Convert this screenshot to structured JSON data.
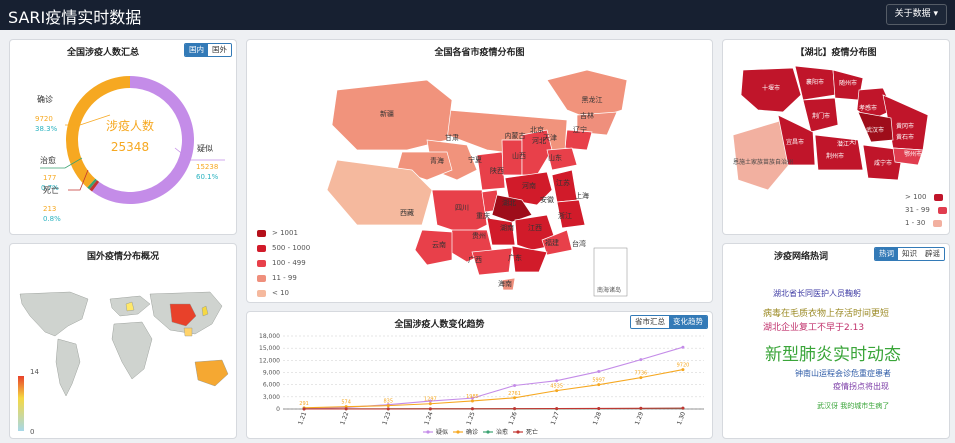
{
  "header": {
    "title": "SARI疫情实时数据",
    "about_label": "关于数据 ▾"
  },
  "summary": {
    "title": "全国涉疫人数汇总",
    "tabs": [
      "国内",
      "国外"
    ],
    "center_label": "涉疫人数",
    "center_value": "25348",
    "items": [
      {
        "label": "确诊",
        "count": "9720",
        "pct": "38.3%",
        "color": "#f6a821"
      },
      {
        "label": "治愈",
        "count": "177",
        "pct": "0.7%",
        "color": "#3ba272"
      },
      {
        "label": "死亡",
        "count": "213",
        "pct": "0.8%",
        "color": "#c23531"
      },
      {
        "label": "疑似",
        "count": "15238",
        "pct": "60.1%",
        "color": "#c48ce8"
      }
    ]
  },
  "china_map": {
    "title": "全国各省市疫情分布图",
    "legend": [
      {
        "label": "> 1001",
        "color": "#b5101a"
      },
      {
        "label": "500 - 1000",
        "color": "#d11b2a"
      },
      {
        "label": "100 - 499",
        "color": "#e8404a"
      },
      {
        "label": "11 - 99",
        "color": "#ef8f7c"
      },
      {
        "label": "< 10",
        "color": "#f5b99e"
      }
    ],
    "labels": [
      "黑龙江",
      "吉林",
      "辽宁",
      "内蒙古",
      "新疆",
      "甘肃",
      "宁夏",
      "青海",
      "西藏",
      "四川",
      "重庆",
      "陕西",
      "山西",
      "河北",
      "北京",
      "天津",
      "山东",
      "河南",
      "湖北",
      "湖南",
      "江苏",
      "安徽",
      "上海",
      "浙江",
      "江西",
      "福建",
      "广东",
      "广西",
      "贵州",
      "云南",
      "海南",
      "台湾"
    ],
    "inset_label": "南海诸岛"
  },
  "hubei_map": {
    "title": "【湖北】疫情分布图",
    "labels": [
      "十堰市",
      "襄阳市",
      "随州市",
      "孝感市",
      "荆门市",
      "黄冈市",
      "武汉市",
      "恩施土家族苗族自治州",
      "宜昌市",
      "荆州市",
      "咸宁市",
      "鄂州市",
      "黄石市",
      "潜江",
      "天门"
    ],
    "legend": [
      {
        "label": "> 100",
        "color": "#c0152a"
      },
      {
        "label": "31 - 99",
        "color": "#e03d4f"
      },
      {
        "label": "1 - 30",
        "color": "#f2b0a0"
      }
    ]
  },
  "world_map": {
    "title": "国外疫情分布概况",
    "scale_max": "14",
    "scale_min": "0"
  },
  "trend": {
    "title": "全国涉疫人数变化趋势",
    "tabs": [
      "省市汇总",
      "变化趋势"
    ],
    "legend": [
      "疑似",
      "确诊",
      "治愈",
      "死亡"
    ]
  },
  "hotwords": {
    "title": "涉疫网络热词",
    "tabs": [
      "热词",
      "知识",
      "辟谣"
    ],
    "words": [
      {
        "text": "湖北省长同医护人员鞠躬",
        "color": "#3d3aa3",
        "size": 8
      },
      {
        "text": "病毒在毛质衣物上存活时间更短",
        "color": "#9b8a24",
        "size": 9
      },
      {
        "text": "湖北企业复工不早于2.13",
        "color": "#c0306b",
        "size": 9
      },
      {
        "text": "新型肺炎实时动态",
        "color": "#3aa539",
        "size": 17
      },
      {
        "text": "钟南山运程会诊危重症患者",
        "color": "#2c5aa6",
        "size": 8
      },
      {
        "text": "疫情拐点将出现",
        "color": "#7a3aa6",
        "size": 8
      },
      {
        "text": "武汉伢 我的城市生病了",
        "color": "#3aa539",
        "size": 7
      }
    ]
  },
  "chart_data": {
    "type": "line",
    "categories": [
      "1.21",
      "1.22",
      "1.23",
      "1.24",
      "1.25",
      "1.26",
      "1.27",
      "1.28",
      "1.29",
      "1.30"
    ],
    "ylim": [
      0,
      18000
    ],
    "yticks": [
      "0",
      "3,000",
      "6,000",
      "9,000",
      "12,000",
      "15,000",
      "18,000"
    ],
    "series": [
      {
        "name": "疑似",
        "color": "#c48ce8",
        "values": [
          37,
          393,
          1072,
          1965,
          2684,
          5794,
          6973,
          9239,
          12167,
          15238
        ]
      },
      {
        "name": "确诊",
        "color": "#f6a821",
        "values": [
          291,
          574,
          835,
          1297,
          1985,
          2761,
          4535,
          5997,
          7736,
          9720
        ]
      },
      {
        "name": "治愈",
        "color": "#3ba272",
        "values": [
          25,
          28,
          34,
          38,
          49,
          51,
          60,
          103,
          124,
          177
        ]
      },
      {
        "name": "死亡",
        "color": "#c23531",
        "values": [
          6,
          17,
          25,
          41,
          56,
          80,
          106,
          132,
          170,
          213
        ]
      }
    ],
    "data_labels": [
      "291",
      "574",
      "835",
      "1297",
      "1985",
      "2761",
      "4535",
      "5997",
      "7736",
      "9720"
    ]
  }
}
